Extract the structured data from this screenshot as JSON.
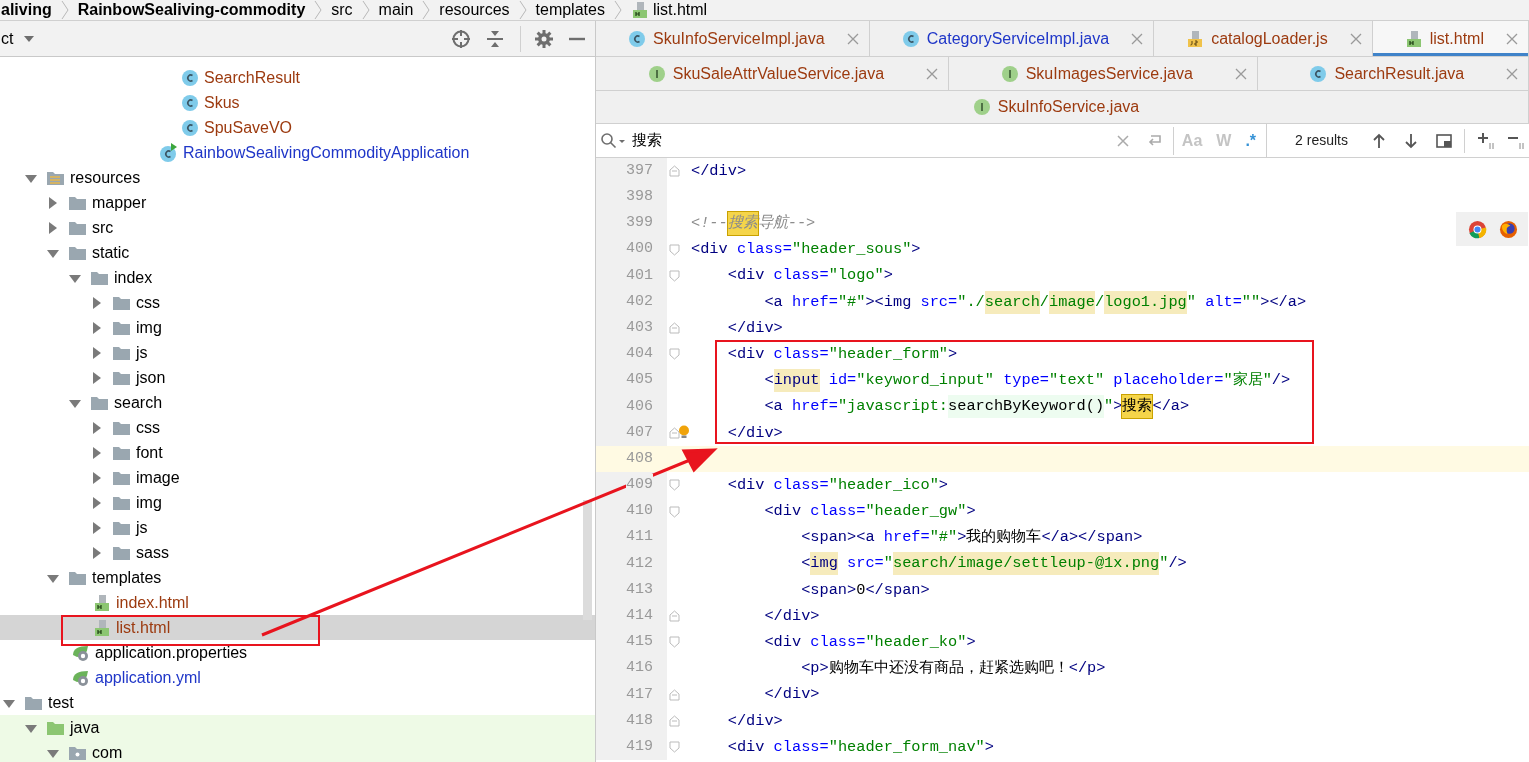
{
  "breadcrumb": [
    {
      "label": "aliving",
      "bold": true
    },
    {
      "label": "RainbowSealiving-commodity",
      "bold": true
    },
    {
      "label": "src",
      "bold": false
    },
    {
      "label": "main",
      "bold": false
    },
    {
      "label": "resources",
      "bold": false
    },
    {
      "label": "templates",
      "bold": false
    },
    {
      "label": "list.html",
      "bold": false,
      "kind": "html"
    }
  ],
  "project_panel": {
    "title": "ct",
    "tree": [
      {
        "children": [
          {
            "children": [
              {
                "children": [
                  {
                    "children": [
                      {
                        "children": [
                          {
                            "children": [
                              {
                                "children": [
                                  {
                                    "label": "SearchResult",
                                    "kind": "class",
                                    "color": "#9c3a0f",
                                    "selected": false
                                  },
                                  {
                                    "label": "Skus",
                                    "kind": "class",
                                    "color": "#9c3a0f",
                                    "selected": false
                                  },
                                  {
                                    "label": "SpuSaveVO",
                                    "kind": "class",
                                    "color": "#9c3a0f",
                                    "selected": false
                                  }
                                ]
                              },
                              {
                                "label": "RainbowSealivingCommodityApplication",
                                "kind": "app",
                                "color": "#1f36c8",
                                "selected": false
                              }
                            ]
                          }
                        ]
                      }
                    ]
                  }
                ]
              }
            ]
          },
          {
            "label": "resources",
            "kind": "resources",
            "color": "#000000",
            "expanded": true,
            "selected": false,
            "children": [
              {
                "label": "mapper",
                "kind": "folder",
                "color": "#000000",
                "expanded": false,
                "selected": false
              },
              {
                "label": "src",
                "kind": "folder",
                "color": "#000000",
                "expanded": false,
                "selected": false
              },
              {
                "label": "static",
                "kind": "folder",
                "color": "#000000",
                "expanded": true,
                "selected": false,
                "children": [
                  {
                    "label": "index",
                    "kind": "folder",
                    "color": "#000000",
                    "expanded": true,
                    "selected": false,
                    "children": [
                      {
                        "label": "css",
                        "kind": "folder",
                        "color": "#000000",
                        "expanded": false,
                        "selected": false
                      },
                      {
                        "label": "img",
                        "kind": "folder",
                        "color": "#000000",
                        "expanded": false,
                        "selected": false
                      },
                      {
                        "label": "js",
                        "kind": "folder",
                        "color": "#000000",
                        "expanded": false,
                        "selected": false
                      },
                      {
                        "label": "json",
                        "kind": "folder",
                        "color": "#000000",
                        "expanded": false,
                        "selected": false
                      }
                    ]
                  },
                  {
                    "label": "search",
                    "kind": "folder",
                    "color": "#000000",
                    "expanded": true,
                    "selected": false,
                    "children": [
                      {
                        "label": "css",
                        "kind": "folder",
                        "color": "#000000",
                        "expanded": false,
                        "selected": false
                      },
                      {
                        "label": "font",
                        "kind": "folder",
                        "color": "#000000",
                        "expanded": false,
                        "selected": false
                      },
                      {
                        "label": "image",
                        "kind": "folder",
                        "color": "#000000",
                        "expanded": false,
                        "selected": false
                      },
                      {
                        "label": "img",
                        "kind": "folder",
                        "color": "#000000",
                        "expanded": false,
                        "selected": false
                      },
                      {
                        "label": "js",
                        "kind": "folder",
                        "color": "#000000",
                        "expanded": false,
                        "selected": false
                      },
                      {
                        "label": "sass",
                        "kind": "folder",
                        "color": "#000000",
                        "expanded": false,
                        "selected": false
                      }
                    ]
                  }
                ]
              },
              {
                "label": "templates",
                "kind": "folder",
                "color": "#000000",
                "expanded": true,
                "selected": false,
                "children": [
                  {
                    "label": "index.html",
                    "kind": "html",
                    "color": "#9c3a0f",
                    "selected": false
                  },
                  {
                    "label": "list.html",
                    "kind": "html",
                    "color": "#9c3a0f",
                    "selected": true
                  }
                ]
              },
              {
                "label": "application.properties",
                "kind": "config",
                "color": "#000000",
                "selected": false
              },
              {
                "label": "application.yml",
                "kind": "config",
                "color": "#1f36c8",
                "selected": false
              }
            ]
          }
        ]
      },
      {
        "label": "test",
        "kind": "folder",
        "color": "#000000",
        "expanded": true,
        "selected": false,
        "children": [
          {
            "label": "java",
            "kind": "test_sources",
            "color": "#000000",
            "expanded": true,
            "selected": false,
            "children": [
              {
                "label": "com",
                "kind": "package",
                "color": "#000000",
                "expanded": true,
                "selected": false
              }
            ]
          }
        ]
      }
    ]
  },
  "tab_rows": [
    {
      "tabs": [
        {
          "label": "SkuInfoServiceImpl.java",
          "kind": "class",
          "color": "#9c3a0f",
          "selected": false,
          "closable": true
        },
        {
          "label": "CategoryServiceImpl.java",
          "kind": "class",
          "color": "#1f36c8",
          "selected": false,
          "closable": true
        },
        {
          "label": "catalogLoader.js",
          "kind": "js",
          "color": "#9c3a0f",
          "selected": false,
          "closable": true
        },
        {
          "label": "list.html",
          "kind": "html",
          "color": "#9c3a0f",
          "selected": true,
          "closable": true
        }
      ]
    },
    {
      "tabs": [
        {
          "label": "SkuSaleAttrValueService.java",
          "kind": "interface",
          "color": "#9c3a0f",
          "selected": false,
          "closable": true
        },
        {
          "label": "SkuImagesService.java",
          "kind": "interface",
          "color": "#9c3a0f",
          "selected": false,
          "closable": true
        },
        {
          "label": "SearchResult.java",
          "kind": "class",
          "color": "#9c3a0f",
          "selected": false,
          "closable": true
        }
      ]
    },
    {
      "tabs": [
        {
          "label": "SkuInfoService.java",
          "kind": "interface",
          "color": "#9c3a0f",
          "selected": false,
          "closable": false
        }
      ]
    }
  ],
  "find_bar": {
    "value": "搜索",
    "toggles": [
      {
        "label": "Aa",
        "on": false
      },
      {
        "label": "W",
        "on": false
      },
      {
        "label": ".*",
        "on": true
      }
    ],
    "results": "2 results"
  },
  "editor": {
    "lines": [
      {
        "number": "397",
        "current": false,
        "fold_end": true,
        "tokens": [
          {
            "text": "</div>",
            "kind": "tag"
          }
        ]
      },
      {
        "number": "398",
        "current": false
      },
      {
        "number": "399",
        "current": false,
        "tokens": [
          {
            "text": "<!--",
            "kind": "cmt"
          },
          {
            "text": "搜索",
            "kind": "cmt_match"
          },
          {
            "text": "导航-->",
            "kind": "cmt"
          }
        ]
      },
      {
        "number": "400",
        "current": false,
        "fold_start": true,
        "tokens": [
          {
            "text": "<div",
            "kind": "tag"
          },
          {
            "text": " class=",
            "kind": "attr"
          },
          {
            "text": "\"header_sous\"",
            "kind": "val"
          },
          {
            "text": ">",
            "kind": "tag"
          }
        ]
      },
      {
        "number": "401",
        "current": false,
        "fold_start": true,
        "tokens": [
          {
            "text": "    <div",
            "kind": "tag"
          },
          {
            "text": " class=",
            "kind": "attr"
          },
          {
            "text": "\"logo\"",
            "kind": "val"
          },
          {
            "text": ">",
            "kind": "tag"
          }
        ]
      },
      {
        "number": "402",
        "current": false,
        "tokens": [
          {
            "text": "        <a",
            "kind": "tag"
          },
          {
            "text": " href=",
            "kind": "attr"
          },
          {
            "text": "\"#\"",
            "kind": "val"
          },
          {
            "text": "><img",
            "kind": "tag"
          },
          {
            "text": " src=",
            "kind": "attr"
          },
          {
            "text": "\"./",
            "kind": "val"
          },
          {
            "text": "search",
            "kind": "val_usage"
          },
          {
            "text": "/",
            "kind": "val"
          },
          {
            "text": "image",
            "kind": "val_usage"
          },
          {
            "text": "/",
            "kind": "val"
          },
          {
            "text": "logo1.jpg",
            "kind": "val_usage"
          },
          {
            "text": "\"",
            "kind": "val"
          },
          {
            "text": " alt=",
            "kind": "attr"
          },
          {
            "text": "\"\"",
            "kind": "val"
          },
          {
            "text": "></a>",
            "kind": "tag"
          }
        ]
      },
      {
        "number": "403",
        "current": false,
        "fold_end": true,
        "tokens": [
          {
            "text": "    </div>",
            "kind": "tag"
          }
        ]
      },
      {
        "number": "404",
        "current": false,
        "fold_start": true,
        "tokens": [
          {
            "text": "    <div",
            "kind": "tag"
          },
          {
            "text": " class=",
            "kind": "attr"
          },
          {
            "text": "\"header_form\"",
            "kind": "val"
          },
          {
            "text": ">",
            "kind": "tag"
          }
        ]
      },
      {
        "number": "405",
        "current": false,
        "tokens": [
          {
            "text": "        <",
            "kind": "tag"
          },
          {
            "text": "input",
            "kind": "tag_usage"
          },
          {
            "text": " id=",
            "kind": "attr"
          },
          {
            "text": "\"keyword_input\"",
            "kind": "val"
          },
          {
            "text": " type=",
            "kind": "attr"
          },
          {
            "text": "\"text\"",
            "kind": "val"
          },
          {
            "text": " placeholder=",
            "kind": "attr"
          },
          {
            "text": "\"家居\"",
            "kind": "val"
          },
          {
            "text": "/>",
            "kind": "tag"
          }
        ]
      },
      {
        "number": "406",
        "current": false,
        "tokens": [
          {
            "text": "        <a",
            "kind": "tag"
          },
          {
            "text": " href=",
            "kind": "attr"
          },
          {
            "text": "\"javascript:",
            "kind": "val"
          },
          {
            "text": "searchByKeyword()",
            "kind": "txt_ref"
          },
          {
            "text": "\"",
            "kind": "val"
          },
          {
            "text": ">",
            "kind": "tag"
          },
          {
            "text": "搜索",
            "kind": "txt_match"
          },
          {
            "text": "</a>",
            "kind": "tag"
          }
        ]
      },
      {
        "number": "407",
        "current": false,
        "fold_end": true,
        "bulb": true,
        "tokens": [
          {
            "text": "    </div>",
            "kind": "tag"
          }
        ]
      },
      {
        "number": "408",
        "current": true
      },
      {
        "number": "409",
        "current": false,
        "fold_start": true,
        "tokens": [
          {
            "text": "    <div",
            "kind": "tag"
          },
          {
            "text": " class=",
            "kind": "attr"
          },
          {
            "text": "\"header_ico\"",
            "kind": "val"
          },
          {
            "text": ">",
            "kind": "tag"
          }
        ]
      },
      {
        "number": "410",
        "current": false,
        "fold_start": true,
        "tokens": [
          {
            "text": "        <div",
            "kind": "tag"
          },
          {
            "text": " class=",
            "kind": "attr"
          },
          {
            "text": "\"header_gw\"",
            "kind": "val"
          },
          {
            "text": ">",
            "kind": "tag"
          }
        ]
      },
      {
        "number": "411",
        "current": false,
        "tokens": [
          {
            "text": "            <span><a",
            "kind": "tag"
          },
          {
            "text": " href=",
            "kind": "attr"
          },
          {
            "text": "\"#\"",
            "kind": "val"
          },
          {
            "text": ">",
            "kind": "tag"
          },
          {
            "text": "我的购物车",
            "kind": "txt"
          },
          {
            "text": "</a></span>",
            "kind": "tag"
          }
        ]
      },
      {
        "number": "412",
        "current": false,
        "tokens": [
          {
            "text": "            <",
            "kind": "tag"
          },
          {
            "text": "img",
            "kind": "tag_usage"
          },
          {
            "text": " src=",
            "kind": "attr"
          },
          {
            "text": "\"",
            "kind": "val"
          },
          {
            "text": "search/image/settleup-@1x.png",
            "kind": "val_usage"
          },
          {
            "text": "\"",
            "kind": "val"
          },
          {
            "text": "/>",
            "kind": "tag"
          }
        ]
      },
      {
        "number": "413",
        "current": false,
        "tokens": [
          {
            "text": "            <span>",
            "kind": "tag"
          },
          {
            "text": "0",
            "kind": "txt"
          },
          {
            "text": "</span>",
            "kind": "tag"
          }
        ]
      },
      {
        "number": "414",
        "current": false,
        "fold_end": true,
        "tokens": [
          {
            "text": "        </div>",
            "kind": "tag"
          }
        ]
      },
      {
        "number": "415",
        "current": false,
        "fold_start": true,
        "tokens": [
          {
            "text": "        <div",
            "kind": "tag"
          },
          {
            "text": " class=",
            "kind": "attr"
          },
          {
            "text": "\"header_ko\"",
            "kind": "val"
          },
          {
            "text": ">",
            "kind": "tag"
          }
        ]
      },
      {
        "number": "416",
        "current": false,
        "tokens": [
          {
            "text": "            <p>",
            "kind": "tag"
          },
          {
            "text": "购物车中还没有商品，赶紧选购吧！",
            "kind": "txt"
          },
          {
            "text": "</p>",
            "kind": "tag"
          }
        ]
      },
      {
        "number": "417",
        "current": false,
        "fold_end": true,
        "tokens": [
          {
            "text": "        </div>",
            "kind": "tag"
          }
        ]
      },
      {
        "number": "418",
        "current": false,
        "fold_end": true,
        "tokens": [
          {
            "text": "    </div>",
            "kind": "tag"
          }
        ]
      },
      {
        "number": "419",
        "current": false,
        "fold_start": true,
        "tokens": [
          {
            "text": "    <div",
            "kind": "tag"
          },
          {
            "text": " class=",
            "kind": "attr"
          },
          {
            "text": "\"header_form_nav\"",
            "kind": "val"
          },
          {
            "text": ">",
            "kind": "tag"
          }
        ]
      }
    ]
  }
}
